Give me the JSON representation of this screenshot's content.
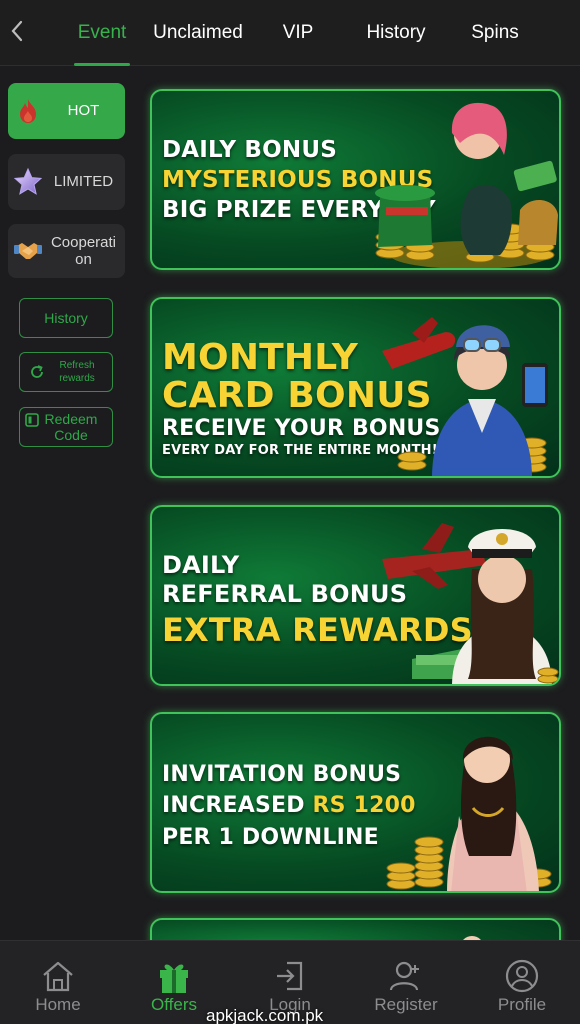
{
  "header": {
    "tabs": [
      {
        "label": "Event",
        "active": true
      },
      {
        "label": "Unclaimed",
        "active": false
      },
      {
        "label": "VIP",
        "active": false
      },
      {
        "label": "History",
        "active": false
      },
      {
        "label": "Spins",
        "active": false
      }
    ]
  },
  "sidebar": {
    "categories": [
      {
        "label": "HOT",
        "icon": "flame-icon",
        "active": true
      },
      {
        "label": "LIMITED",
        "icon": "star-icon",
        "active": false
      },
      {
        "label": "Cooperati on",
        "icon": "handshake-icon",
        "active": false
      }
    ],
    "history_label": "History",
    "refresh_label": "Refresh rewards",
    "redeem_label": "Redeem Code"
  },
  "banners": [
    {
      "lines": [
        "DAILY BONUS",
        "MYSTERIOUS BONUS",
        "BIG PRIZE EVERYDAY"
      ]
    },
    {
      "lines": [
        "MONTHLY",
        "CARD BONUS",
        "RECEIVE YOUR BONUS",
        "EVERY DAY FOR THE ENTIRE MONTH!"
      ]
    },
    {
      "lines": [
        "DAILY",
        "REFERRAL BONUS",
        "EXTRA REWARDS"
      ]
    },
    {
      "lines": [
        "INVITATION BONUS",
        "INCREASED",
        "RS 1200",
        "PER 1 DOWNLINE"
      ]
    }
  ],
  "bottom_nav": [
    {
      "label": "Home",
      "icon": "home-icon",
      "active": false
    },
    {
      "label": "Offers",
      "icon": "gift-icon",
      "active": true
    },
    {
      "label": "Login",
      "icon": "login-icon",
      "active": false
    },
    {
      "label": "Register",
      "icon": "add-user-icon",
      "active": false
    },
    {
      "label": "Profile",
      "icon": "profile-icon",
      "active": false
    }
  ],
  "watermark": "apkjack.com.pk",
  "colors": {
    "accent": "#35a84a",
    "gold": "#f7d433",
    "background": "#1c1c1e",
    "banner_green": "#064a22"
  }
}
